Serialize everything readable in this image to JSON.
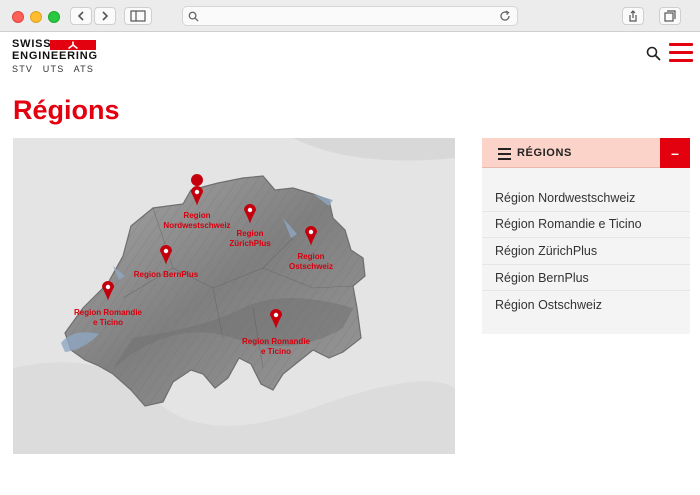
{
  "header": {
    "logo_line1": "SWISS",
    "logo_line2": "ENGINEERING",
    "logo_line3": "STV  UTS  ATS"
  },
  "page_title": "Régions",
  "map": {
    "pins": [
      {
        "label1": "Region",
        "label2": "Nordwestschweiz"
      },
      {
        "label1": "Region",
        "label2": "ZürichPlus"
      },
      {
        "label1": "Region",
        "label2": "Ostschweiz"
      },
      {
        "label1": "Region BernPlus",
        "label2": ""
      },
      {
        "label1": "Region Romandie",
        "label2": "e Ticino"
      },
      {
        "label1": "Region Romandie",
        "label2": "e Ticino"
      }
    ]
  },
  "sidebar": {
    "heading": "RÉGIONS",
    "toggle": "–",
    "items": [
      {
        "label": "Région Nordwestschweiz"
      },
      {
        "label": "Région Romandie e Ticino"
      },
      {
        "label": "Région ZürichPlus"
      },
      {
        "label": "Région BernPlus"
      },
      {
        "label": "Région Ostschweiz"
      }
    ]
  },
  "colors": {
    "accent": "#e3000f",
    "panel_header": "#fbd3c8"
  }
}
